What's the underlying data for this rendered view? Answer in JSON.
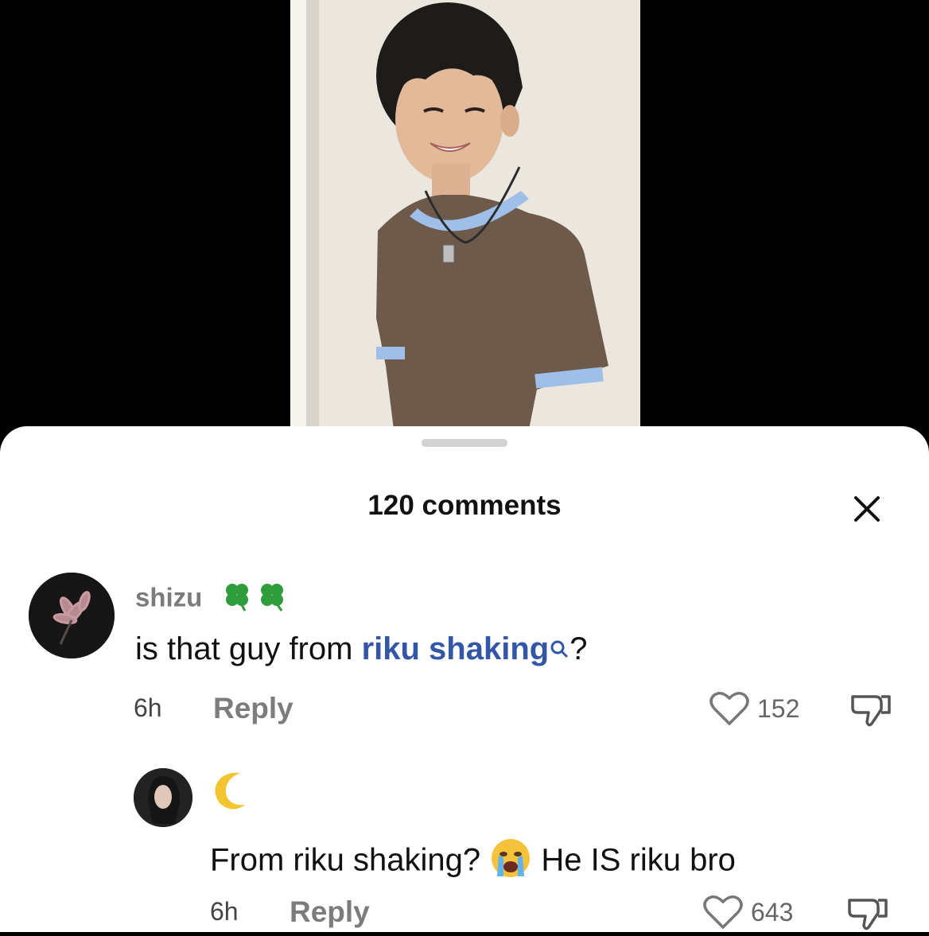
{
  "sheet": {
    "title": "120 comments",
    "close_icon": "close-icon",
    "handle": "drag-handle"
  },
  "comments": [
    {
      "username": "shizu",
      "username_decor": "clover-emoji",
      "text_before": "is that guy from ",
      "mention": "riku shaking",
      "text_after": "?",
      "time": "6h",
      "reply_label": "Reply",
      "likes": "152"
    }
  ],
  "replies": [
    {
      "username_decor": "crescent-moon-emoji",
      "text_before": "From riku shaking? ",
      "emoji": "crying-face-emoji",
      "text_after": " He IS riku bro",
      "time": "6h",
      "reply_label": "Reply",
      "likes": "643"
    }
  ],
  "colors": {
    "mention": "#3456a6",
    "muted": "#7c7c7c",
    "sleeve_trim": "#9fbfe8",
    "shirt": "#6e5a4b"
  }
}
